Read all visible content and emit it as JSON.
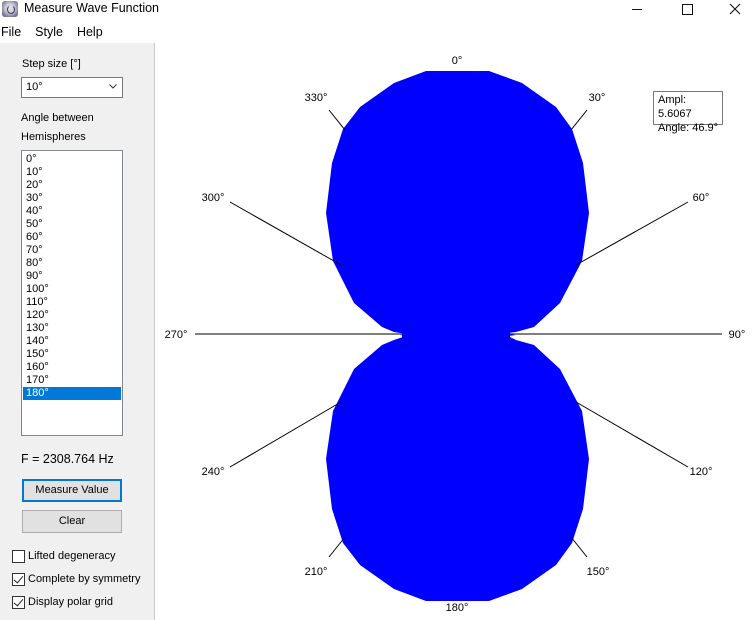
{
  "window": {
    "title": "Measure Wave Function"
  },
  "menu": [
    "File",
    "Style",
    "Help"
  ],
  "left": {
    "step_label": "Step size [°]",
    "step_value": "10°",
    "angle_label_1": "Angle between",
    "angle_label_2": "Hemispheres",
    "angles": [
      "0°",
      "10°",
      "20°",
      "30°",
      "40°",
      "50°",
      "60°",
      "70°",
      "80°",
      "90°",
      "100°",
      "110°",
      "120°",
      "130°",
      "140°",
      "150°",
      "160°",
      "170°",
      "180°"
    ],
    "selected_angle": "180°",
    "frequency": "F = 2308.764 Hz",
    "measure_button": "Measure Value",
    "clear_button": "Clear",
    "checkboxes": [
      {
        "label": "Lifted degeneracy",
        "checked": false
      },
      {
        "label": "Complete by symmetry",
        "checked": true
      },
      {
        "label": "Display polar grid",
        "checked": true
      }
    ]
  },
  "plot": {
    "angle_labels": [
      "0°",
      "30°",
      "60°",
      "90°",
      "120°",
      "150°",
      "180°",
      "210°",
      "240°",
      "270°",
      "300°",
      "330°"
    ],
    "fill_color": "#0000ff",
    "tooltip": {
      "ampl": "Ampl: 5.6067",
      "angle": "Angle: 46.9°"
    }
  }
}
